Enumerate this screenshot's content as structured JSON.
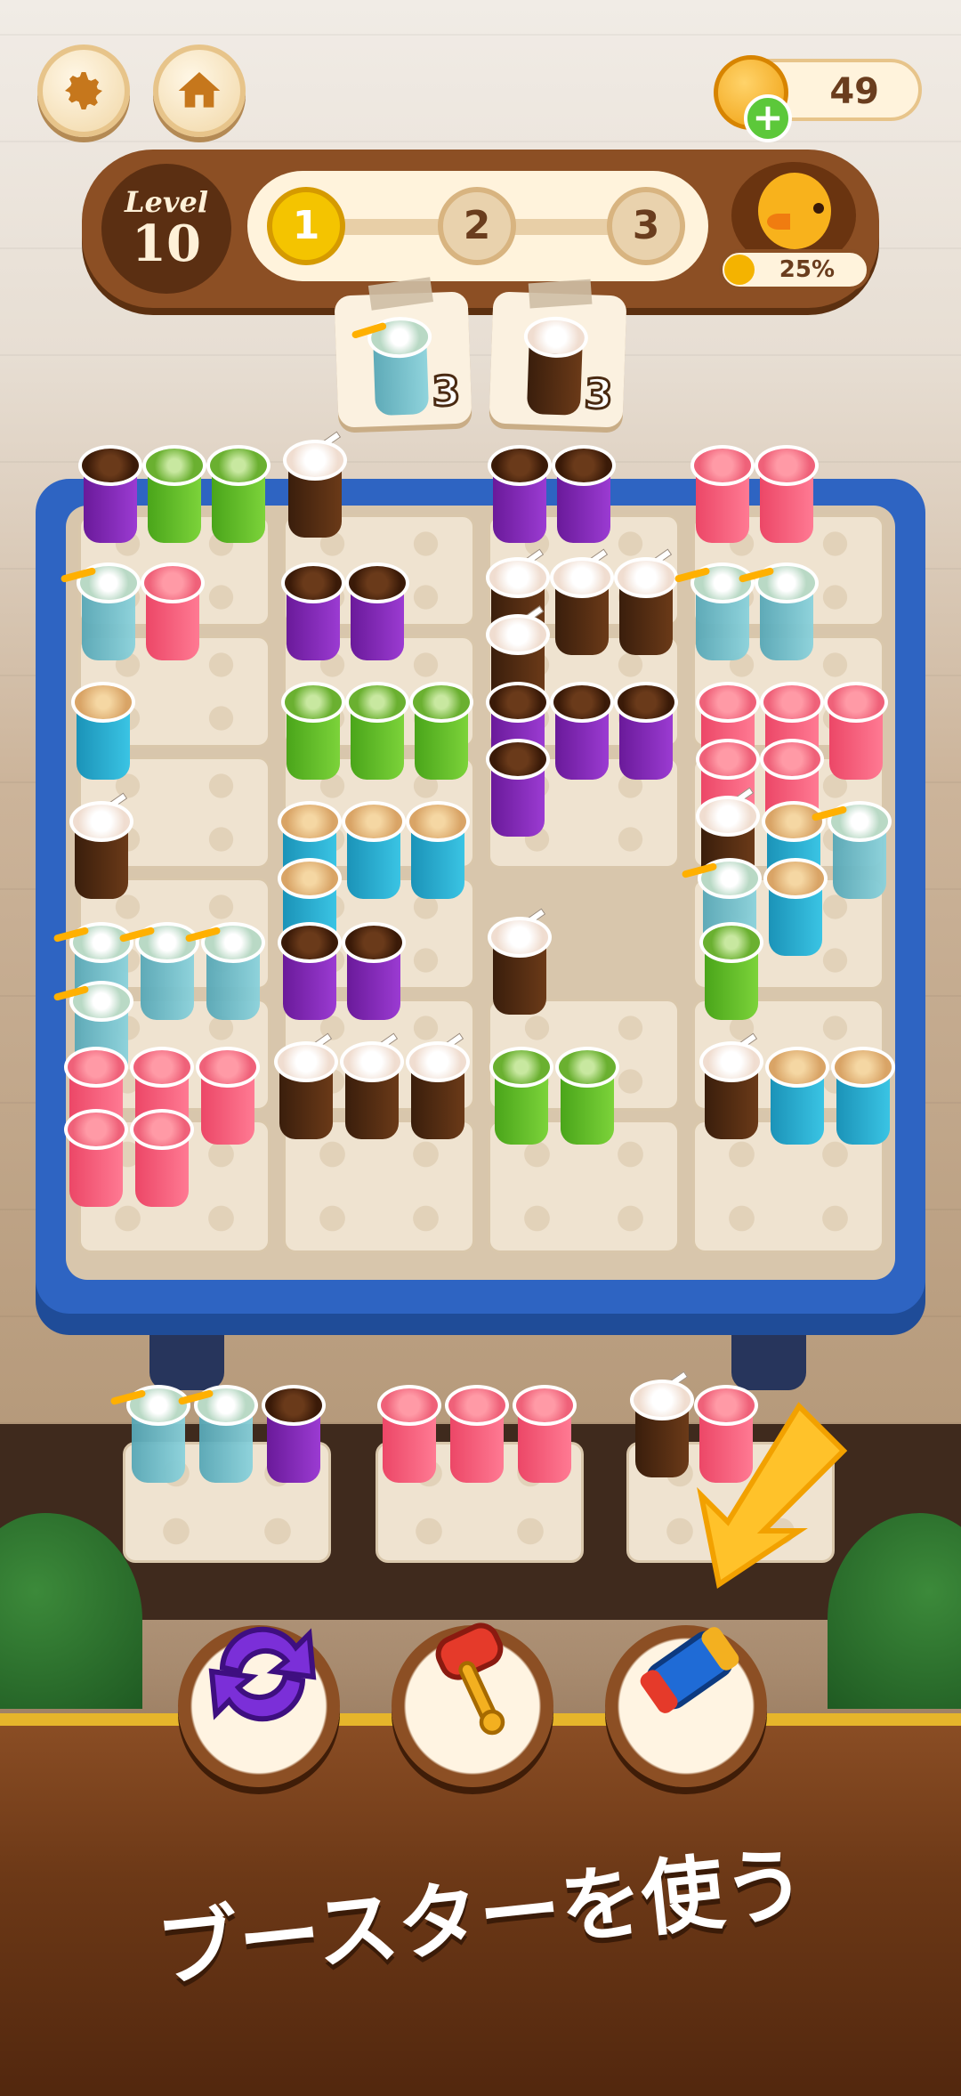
{
  "coins": {
    "value": "49"
  },
  "level": {
    "word": "Level",
    "number": "10"
  },
  "stages": [
    "1",
    "2",
    "3"
  ],
  "chick": {
    "percent": "25%"
  },
  "goals": [
    {
      "icon": "flower-drink-icon",
      "count": "3"
    },
    {
      "icon": "frappe-drink-icon",
      "count": "3"
    }
  ],
  "colors": {
    "table": "#2e64c2",
    "accent": "#e6b52b",
    "panel": "#6d3917"
  },
  "footer": {
    "text": "ブースターを使う"
  },
  "boosters": [
    "shuffle-booster",
    "hammer-booster",
    "rocket-booster"
  ]
}
